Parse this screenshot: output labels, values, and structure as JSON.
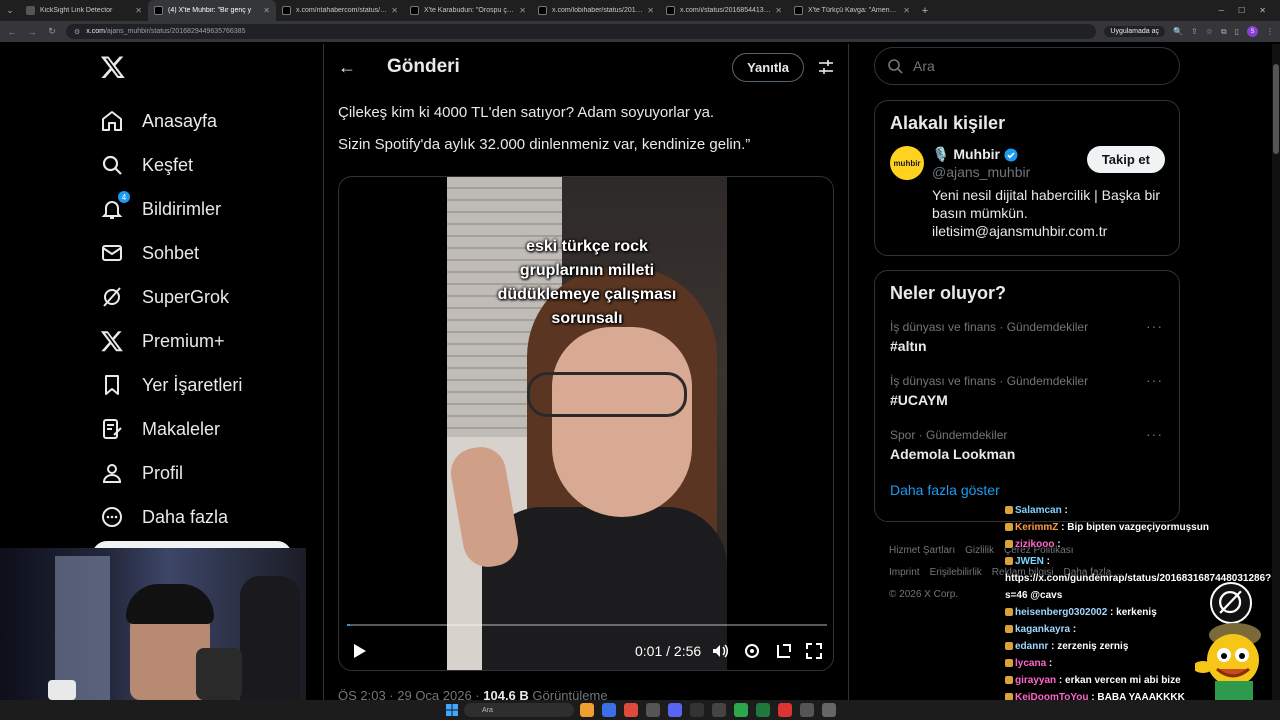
{
  "browser": {
    "tabs": [
      {
        "title": "KickSight Link Detector",
        "active": false
      },
      {
        "title": "(4) X'te Muhbir: \"Bir genç y",
        "active": true
      },
      {
        "title": "x.com/ntahabercom/status/201",
        "active": false
      },
      {
        "title": "X'te Karabudun: \"Orospu çocuğ",
        "active": false
      },
      {
        "title": "x.com/lobihaber/status/201657",
        "active": false
      },
      {
        "title": "x.com/i/status/2016854413369",
        "active": false
      },
      {
        "title": "X'te Türkçü Kavga: \"Amerika'y",
        "active": false
      }
    ],
    "url_host": "x.com",
    "url_path": "/ajans_muhbir/status/2016829449635766385",
    "open_in_app": "Uygulamada aç"
  },
  "sidebar": {
    "notifications_badge": "4",
    "items": [
      {
        "label": "Anasayfa",
        "icon": "home-icon"
      },
      {
        "label": "Keşfet",
        "icon": "search-icon"
      },
      {
        "label": "Bildirimler",
        "icon": "bell-icon"
      },
      {
        "label": "Sohbet",
        "icon": "mail-icon"
      },
      {
        "label": "SuperGrok",
        "icon": "grok-icon"
      },
      {
        "label": "Premium+",
        "icon": "x-icon"
      },
      {
        "label": "Yer İşaretleri",
        "icon": "bookmark-icon"
      },
      {
        "label": "Makaleler",
        "icon": "article-icon"
      },
      {
        "label": "Profil",
        "icon": "profile-icon"
      },
      {
        "label": "Daha fazla",
        "icon": "more-icon"
      }
    ]
  },
  "main": {
    "title": "Gönderi",
    "reply_label": "Yanıtla",
    "text_lines": [
      "Çilekeş kim ki 4000 TL'den satıyor? Adam soyuyorlar ya.",
      "Sizin Spotify'da aylık 32.000 dinlenmeniz var, kendinize gelin.”"
    ],
    "video": {
      "caption": "eski türkçe rock\ngruplarının milleti\ndüdüklemeye çalışması\nsorunsalı",
      "time": "0:01 / 2:56",
      "progress": 0.006
    },
    "meta": {
      "time_date": "ÖS 2:03 · 29 Oca 2026 · ",
      "views": "104,6 B",
      "views_label": " Görüntüleme"
    }
  },
  "right": {
    "search_placeholder": "Ara",
    "related_title": "Alakalı kişiler",
    "person": {
      "name": "🎙️ Muhbir",
      "handle": "@ajans_muhbir",
      "bio": "Yeni nesil dijital habercilik | Başka bir basın mümkün. iletisim@ajansmuhbir.com.tr",
      "follow_label": "Takip et",
      "avatar_text": "muhbir"
    },
    "trends_title": "Neler oluyor?",
    "trends": [
      {
        "meta": "İş dünyası ve finans · Gündemdekiler",
        "name": "#altın"
      },
      {
        "meta": "İş dünyası ve finans · Gündemdekiler",
        "name": "#UCAYM"
      },
      {
        "meta": "Spor · Gündemdekiler",
        "name": "Ademola Lookman"
      }
    ],
    "show_more": "Daha fazla göster",
    "footer": [
      "Hizmet Şartları",
      "Gizlilik",
      "Çerez Politikası",
      "Imprint",
      "Erişilebilirlik",
      "Reklam bilgisi",
      "Daha fazla ...",
      "© 2026 X Corp."
    ]
  },
  "chat": [
    {
      "user": "Salamcan",
      "msg": "",
      "color": "#7fd3ff"
    },
    {
      "user": "KerimmZ",
      "msg": "Bip bipten vazgeçiyormuşsun",
      "color": "#ff9a3d"
    },
    {
      "user": "zizikooo",
      "msg": "",
      "color": "#ff66cc"
    },
    {
      "user": "JWEN",
      "msg": "https://x.com/gundemrap/status/2016831687448031286?s=46 @cavs",
      "color": "#7fd3ff"
    },
    {
      "user": "heisenberg0302002",
      "msg": "kerkeniş",
      "color": "#9fd7ff"
    },
    {
      "user": "kagankayra",
      "msg": "",
      "color": "#9fd7ff"
    },
    {
      "user": "edannr",
      "msg": "zerzeniş zerniş",
      "color": "#9fd7ff"
    },
    {
      "user": "lycana",
      "msg": "",
      "color": "#ff66cc"
    },
    {
      "user": "girayyan",
      "msg": "erkan vercen mi abi bize",
      "color": "#ff66cc"
    },
    {
      "user": "KeiDoomToYou",
      "msg": "BABA YAAAKKKK",
      "color": "#ff66cc"
    }
  ],
  "taskbar": {
    "search_label": "Ara"
  }
}
